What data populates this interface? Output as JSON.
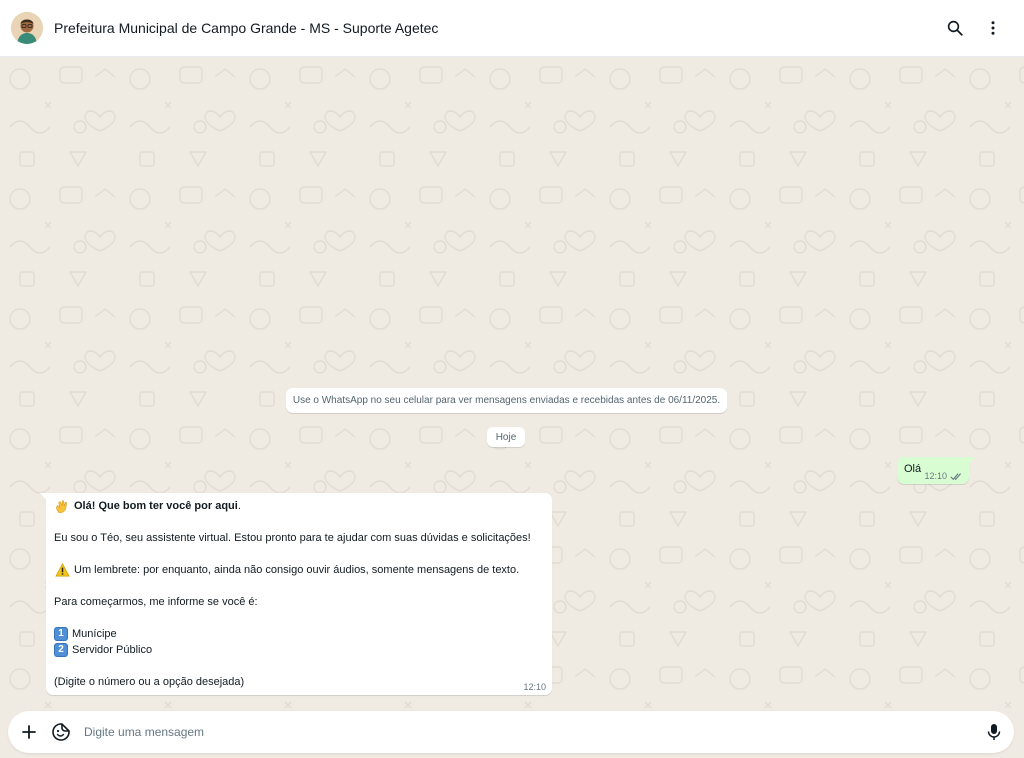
{
  "header": {
    "title": "Prefeitura Municipal de Campo Grande - MS - Suporte Agetec",
    "avatar_icon": "avatar-illustration",
    "search_icon": "search-icon",
    "menu_icon": "more-vertical-icon"
  },
  "chat": {
    "system_notice": "Use o WhatsApp no seu celular para ver mensagens enviadas e recebidas antes de 06/11/2025.",
    "date_chip": "Hoje",
    "outgoing": {
      "text": "Olá",
      "time": "12:10",
      "status_icon": "double-check-icon"
    },
    "incoming": {
      "greeting": "Olá! Que bom ter você por aqui",
      "greeting_end": ".",
      "intro": "Eu sou o Téo, seu assistente virtual. Estou pronto para te ajudar com suas dúvidas e solicitações!",
      "warning": "Um lembrete: por enquanto, ainda não consigo ouvir áudios, somente mensagens de texto.",
      "prompt": "Para começarmos, me informe se você é:",
      "option1_key": "1",
      "option1": "Munícipe",
      "option2_key": "2",
      "option2": "Servidor Público",
      "hint": "(Digite o número ou a opção desejada)",
      "time": "12:10"
    }
  },
  "composer": {
    "placeholder": "Digite uma mensagem",
    "attach_icon": "plus-icon",
    "sticker_icon": "sticker-icon",
    "mic_icon": "microphone-icon"
  },
  "colors": {
    "chat_background": "#efeae2",
    "outgoing_bubble": "#d9fdd3",
    "incoming_bubble": "#ffffff",
    "check_color": "#667781"
  }
}
